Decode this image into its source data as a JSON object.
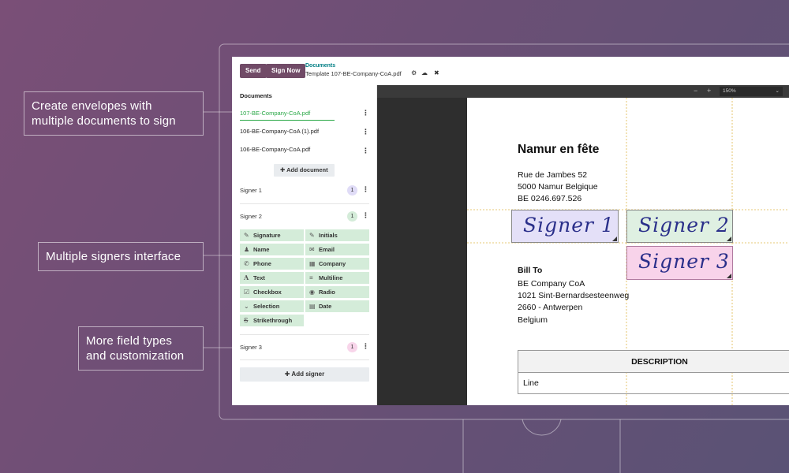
{
  "callouts": {
    "envelopes": [
      "Create envelopes with",
      "multiple documents to sign"
    ],
    "signers": [
      "Multiple signers interface"
    ],
    "fields": [
      "More field types",
      "and customization"
    ]
  },
  "topbar": {
    "send_label": "Send",
    "sign_now_label": "Sign Now",
    "breadcrumb_parent": "Documents",
    "breadcrumb_current": "Template 107-BE-Company-CoA.pdf",
    "icons": [
      "gear-icon",
      "cloud-upload-icon",
      "close-icon"
    ]
  },
  "sidebar": {
    "documents_title": "Documents",
    "documents": [
      {
        "name": "107-BE-Company-CoA.pdf",
        "active": true
      },
      {
        "name": "106-BE-Company-CoA (1).pdf",
        "active": false
      },
      {
        "name": "106-BE-Company-CoA.pdf",
        "active": false
      }
    ],
    "add_document_label": "Add document",
    "signers": [
      {
        "label": "Signer 1",
        "count": "1",
        "color": "#e0dcf7"
      },
      {
        "label": "Signer 2",
        "count": "1",
        "color": "#d4ecd9"
      },
      {
        "label": "Signer 3",
        "count": "1",
        "color": "#f8d5ea"
      }
    ],
    "fields": [
      {
        "label": "Signature",
        "icon": "pen-icon"
      },
      {
        "label": "Initials",
        "icon": "edit-icon"
      },
      {
        "label": "Name",
        "icon": "user-icon"
      },
      {
        "label": "Email",
        "icon": "envelope-icon"
      },
      {
        "label": "Phone",
        "icon": "phone-icon"
      },
      {
        "label": "Company",
        "icon": "building-icon"
      },
      {
        "label": "Text",
        "icon": "font-icon"
      },
      {
        "label": "Multiline",
        "icon": "lines-icon"
      },
      {
        "label": "Checkbox",
        "icon": "checkbox-icon"
      },
      {
        "label": "Radio",
        "icon": "radio-icon"
      },
      {
        "label": "Selection",
        "icon": "chevron-down-icon"
      },
      {
        "label": "Date",
        "icon": "calendar-icon"
      },
      {
        "label": "Strikethrough",
        "icon": "strikethrough-icon"
      }
    ],
    "add_signer_label": "Add signer"
  },
  "viewer": {
    "zoom": "150%"
  },
  "document": {
    "title": "Namur en fête",
    "address": [
      "Rue de Jambes 52",
      "5000 Namur Belgique",
      "BE 0246.697.526"
    ],
    "signature_fields": [
      {
        "label": "Signer 1",
        "color": "#e4e0f8"
      },
      {
        "label": "Signer 2",
        "color": "#dff0e2"
      },
      {
        "label": "Signer 3",
        "color": "#f8d3ea"
      }
    ],
    "bill_to_heading": "Bill To",
    "bill_to": [
      "BE Company CoA",
      "1021 Sint-Bernardsesteenweg",
      "2660 - Antwerpen",
      "Belgium"
    ],
    "table_header": "DESCRIPTION",
    "table_rows": [
      "Line"
    ]
  }
}
